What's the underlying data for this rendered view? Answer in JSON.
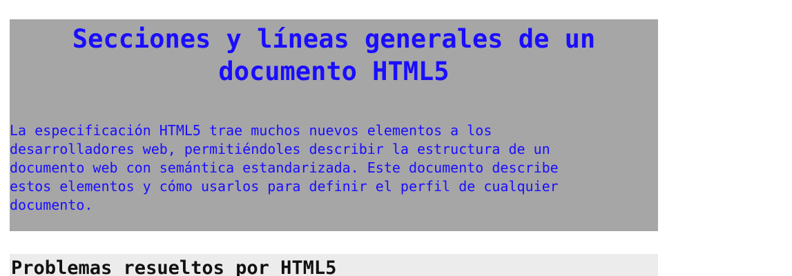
{
  "header": {
    "title": "Secciones y líneas generales de un documento HTML5",
    "intro": "La especificación HTML5 trae muchos nuevos elementos a los\ndesarrolladores web, permitiéndoles describir la estructura de un\ndocumento web con semántica estandarizada. Este documento describe\nestos elementos y cómo usarlos para definir el perfil de cualquier\ndocumento."
  },
  "section": {
    "heading": "Problemas resueltos por HTML5"
  },
  "colors": {
    "header_background": "#a6a6a6",
    "header_text": "#1a0dff",
    "section_background": "#ececec",
    "section_text": "#111111"
  }
}
